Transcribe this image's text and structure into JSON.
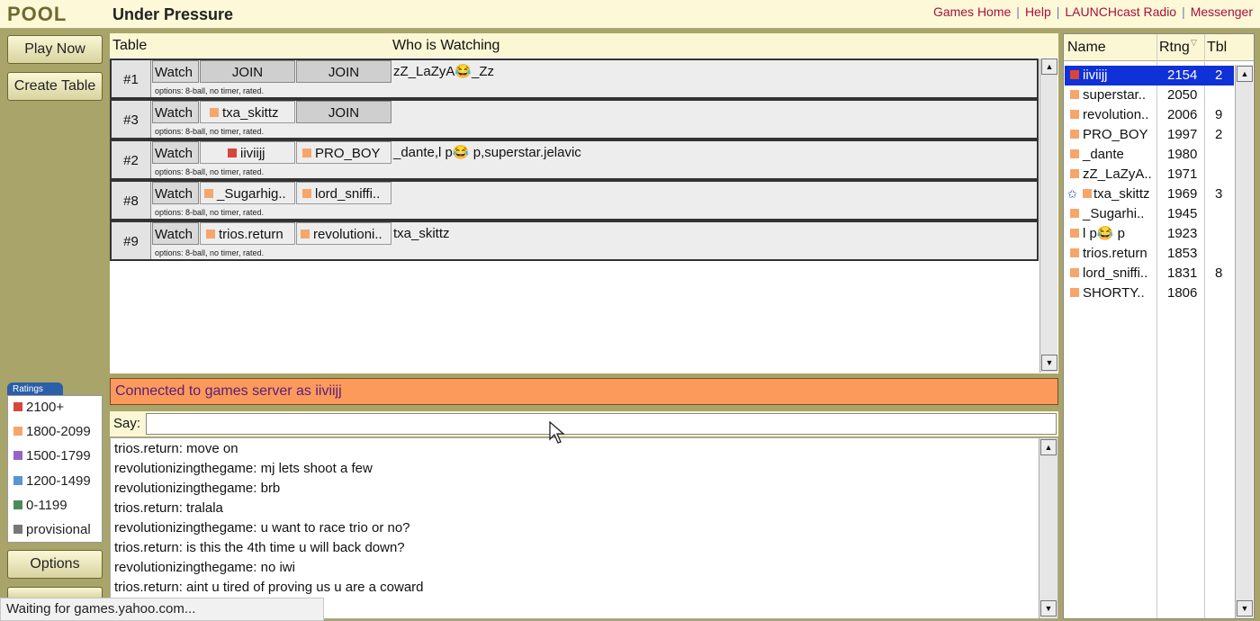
{
  "header": {
    "logo": "POOL",
    "room_title": "Under Pressure",
    "links": [
      "Games Home",
      "Help",
      "LAUNCHcast Radio",
      "Messenger"
    ],
    "separator": "|"
  },
  "left": {
    "play_now": "Play Now",
    "create_table": "Create Table",
    "options": "Options",
    "ratings_title": "Ratings",
    "ratings": [
      {
        "label": "2100+",
        "color": "#d9453a"
      },
      {
        "label": "1800-2099",
        "color": "#f6a66a"
      },
      {
        "label": "1500-1799",
        "color": "#9a62c4"
      },
      {
        "label": "1200-1499",
        "color": "#5a94d4"
      },
      {
        "label": "0-1199",
        "color": "#4f8a5c"
      },
      {
        "label": "provisional",
        "color": "#777777"
      }
    ]
  },
  "status_bar": "Waiting for games.yahoo.com...",
  "tables": {
    "col_table": "Table",
    "col_watching": "Who is Watching",
    "options_text": "options: 8-ball, no timer, rated.",
    "watch_label": "Watch",
    "rows": [
      {
        "num": "#1",
        "seat1": "JOIN",
        "seat2": "JOIN",
        "watchers": "zZ_LaZyA😂_Zz"
      },
      {
        "num": "#3",
        "seat1": "txa_skittz",
        "seat2": "JOIN",
        "watchers": ""
      },
      {
        "num": "#2",
        "seat1": "iiviijj",
        "seat2": "PRO_BOY",
        "watchers": "_dante,l  p😂 p,superstar.jelavic"
      },
      {
        "num": "#8",
        "seat1": "_Sugarhig..",
        "seat2": "lord_sniffi..",
        "watchers": ""
      },
      {
        "num": "#9",
        "seat1": "trios.return",
        "seat2": "revolutioni..",
        "watchers": "txa_skittz"
      }
    ]
  },
  "connected_message": "Connected to games server as iiviijj",
  "chat": {
    "say_label": "Say:",
    "input_value": "",
    "lines": [
      "trios.return: move on",
      "revolutionizingthegame: mj lets shoot a few",
      "revolutionizingthegame: brb",
      "trios.return: tralala",
      "revolutionizingthegame: u want to race trio or no?",
      "trios.return: is this the 4th time u will back down?",
      "revolutionizingthegame: no iwi",
      "trios.return: aint u tired of proving us u are a coward"
    ]
  },
  "players": {
    "col_name": "Name",
    "col_rating": "Rtng",
    "col_table": "Tbl",
    "rows": [
      {
        "name": "iiviijj",
        "rating": "2154",
        "table": "2",
        "color": "#d9453a",
        "selected": true
      },
      {
        "name": "superstar..",
        "rating": "2050",
        "table": "",
        "color": "#f6a66a"
      },
      {
        "name": "revolution..",
        "rating": "2006",
        "table": "9",
        "color": "#f6a66a"
      },
      {
        "name": "PRO_BOY",
        "rating": "1997",
        "table": "2",
        "color": "#f6a66a"
      },
      {
        "name": "_dante",
        "rating": "1980",
        "table": "",
        "color": "#f6a66a"
      },
      {
        "name": "zZ_LaZyA..",
        "rating": "1971",
        "table": "",
        "color": "#f6a66a"
      },
      {
        "name": "txa_skittz",
        "rating": "1969",
        "table": "3",
        "color": "#f6a66a",
        "star": true
      },
      {
        "name": "_Sugarhi..",
        "rating": "1945",
        "table": "",
        "color": "#f6a66a"
      },
      {
        "name": "l   p😂  p",
        "rating": "1923",
        "table": "",
        "color": "#f6a66a"
      },
      {
        "name": "trios.return",
        "rating": "1853",
        "table": "",
        "color": "#f6a66a"
      },
      {
        "name": "lord_sniffi..",
        "rating": "1831",
        "table": "8",
        "color": "#f6a66a"
      },
      {
        "name": "SHORTY..",
        "rating": "1806",
        "table": "",
        "color": "#f6a66a"
      }
    ]
  }
}
